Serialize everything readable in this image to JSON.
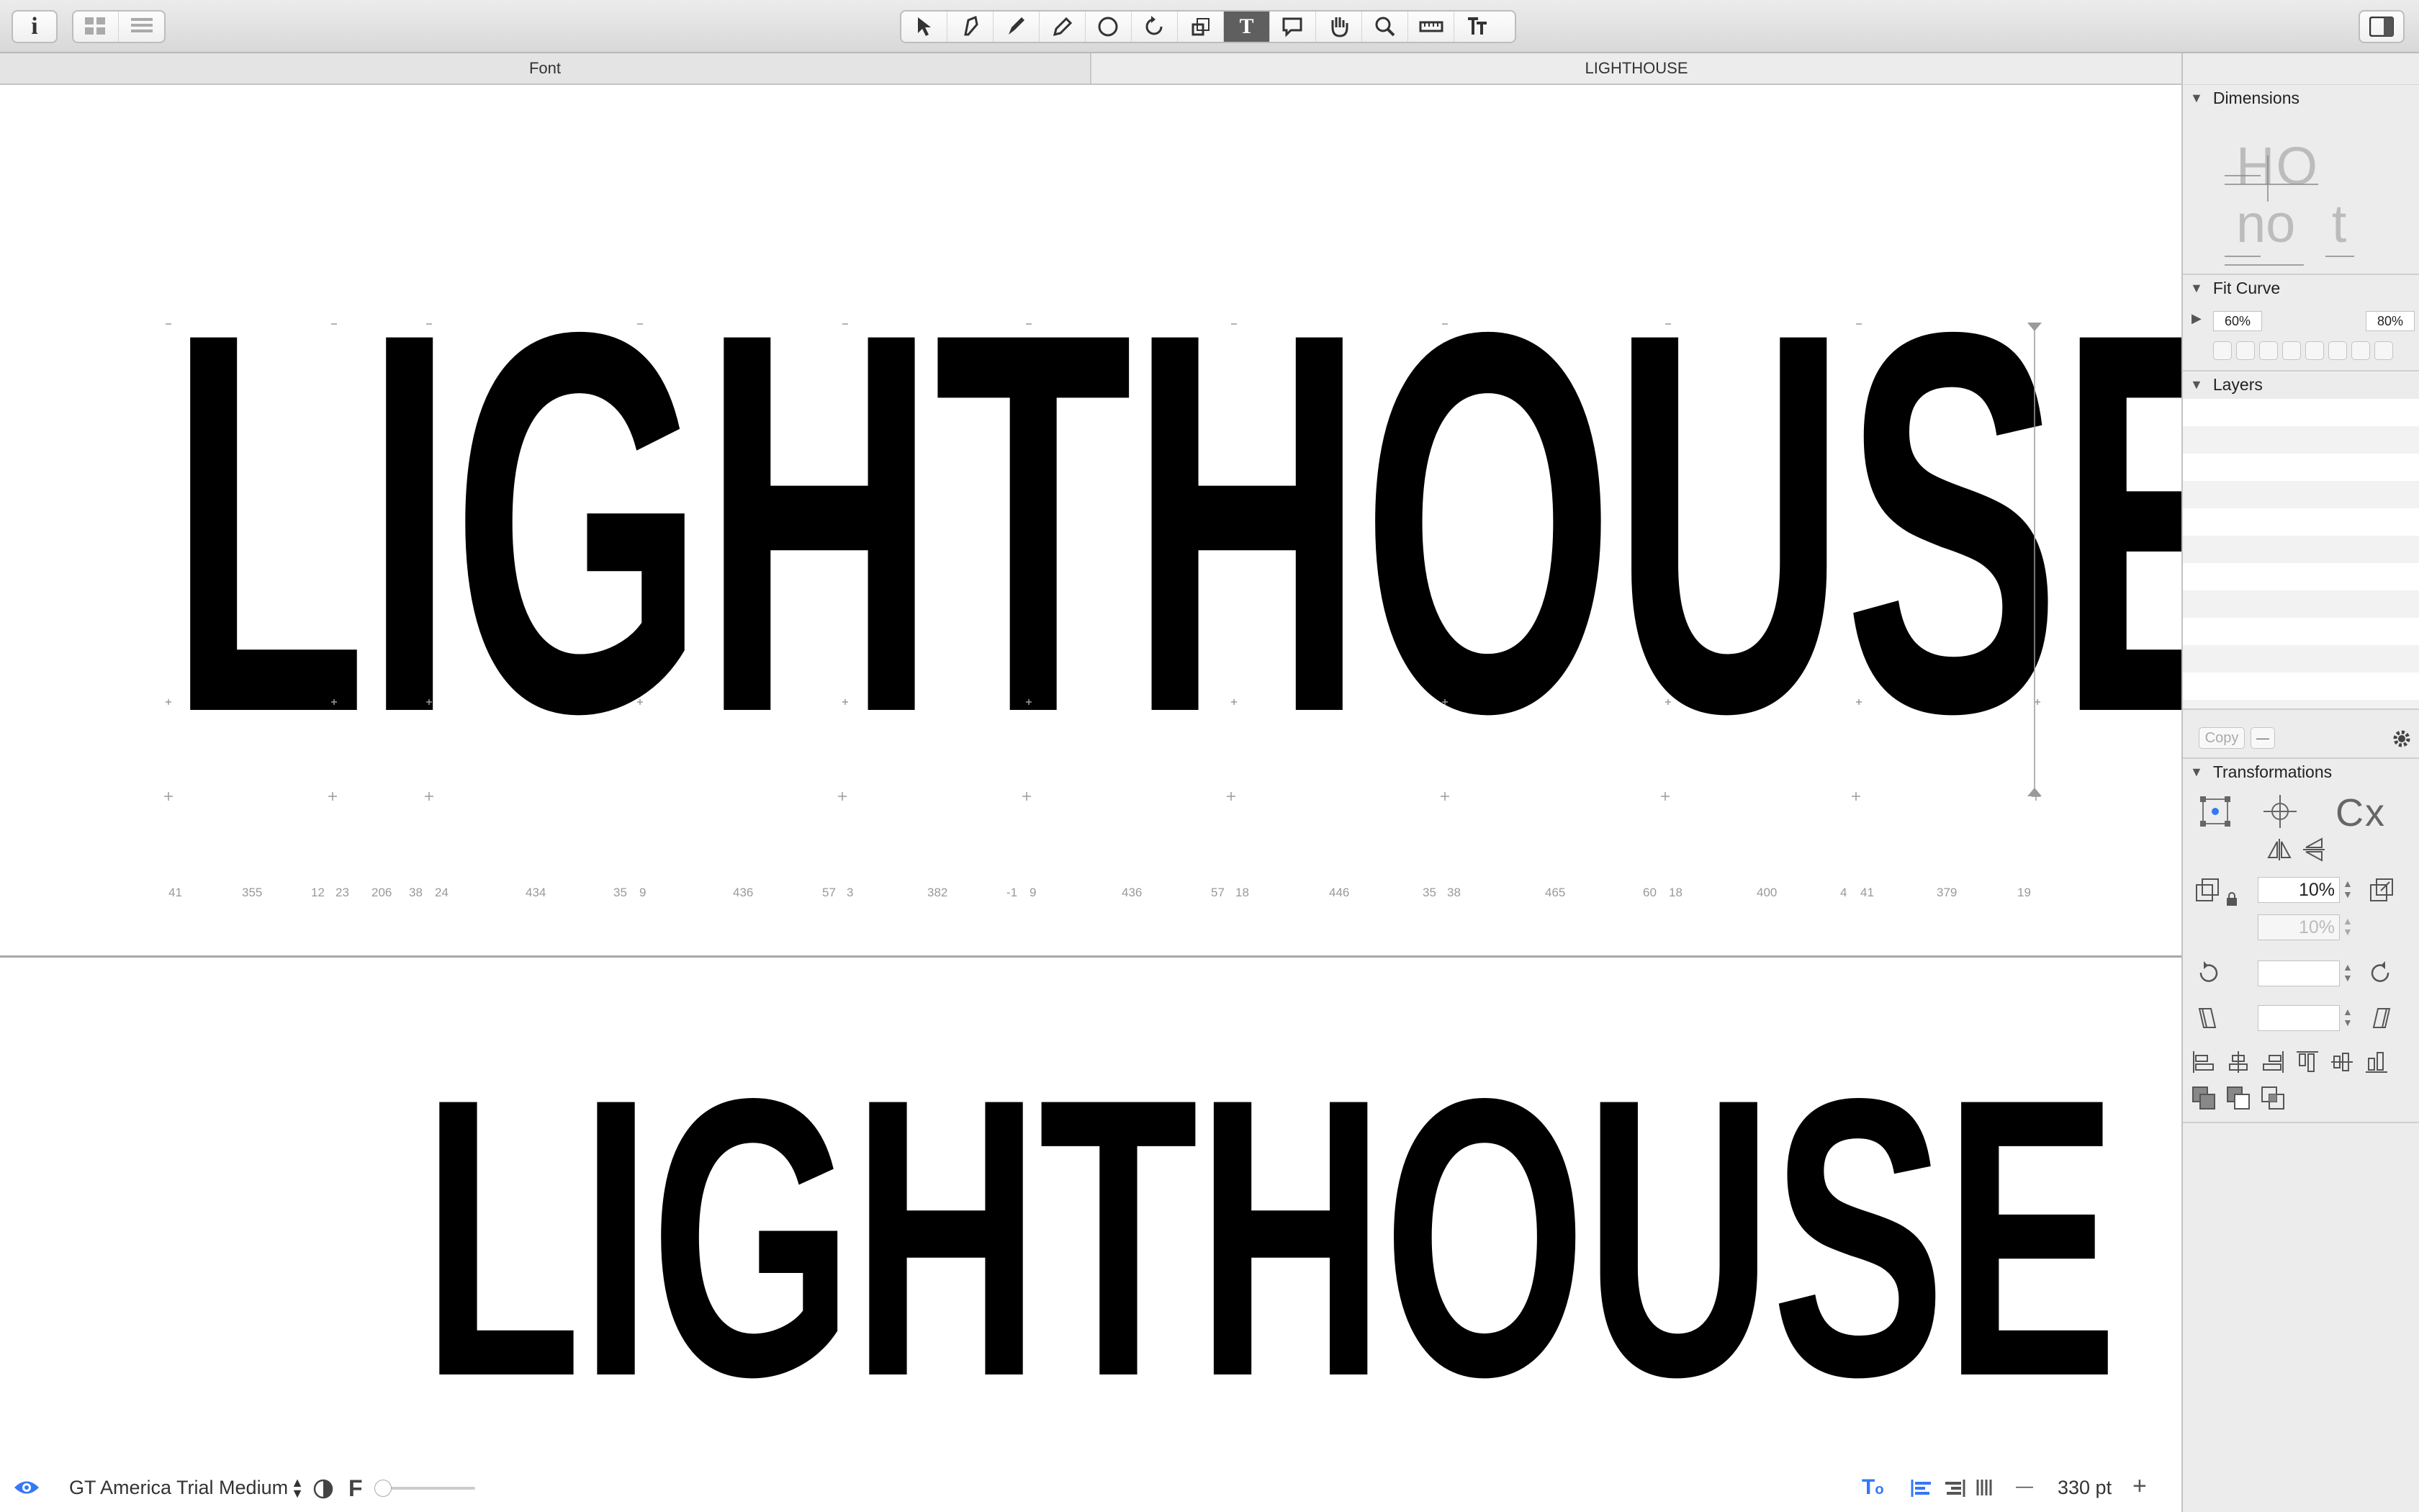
{
  "tabs": {
    "left": "Font",
    "right": "LIGHTHOUSE"
  },
  "canvas": {
    "preview_text": "LIGHTHOUSE",
    "sample_text": "LIGHTHOUSE",
    "metrics": [
      "41",
      "355",
      "12",
      "23",
      "206",
      "38",
      "24",
      "434",
      "35",
      "9",
      "436",
      "57",
      "3",
      "382",
      "-1",
      "9",
      "436",
      "57",
      "18",
      "446",
      "35",
      "38",
      "465",
      "60",
      "18",
      "400",
      "4",
      "41",
      "379",
      "19"
    ]
  },
  "panel": {
    "dimensions": {
      "title": "Dimensions",
      "line1": "HO",
      "line2": "no t"
    },
    "fit_curve": {
      "title": "Fit Curve",
      "left_value": "60%",
      "right_value": "80%"
    },
    "layers": {
      "title": "Layers",
      "copy_label": "Copy",
      "minus_label": "—"
    },
    "transformations": {
      "title": "Transformations",
      "center_label": "Cx",
      "scale_x": "10%",
      "scale_y": "10%",
      "rotate": "",
      "slant": ""
    }
  },
  "status": {
    "font_name": "GT America Trial Medium",
    "point_size": "330 pt",
    "minus": "—",
    "plus": "+"
  },
  "colors": {
    "accent": "#3478f6",
    "active_tool": "#5f5f5f"
  }
}
